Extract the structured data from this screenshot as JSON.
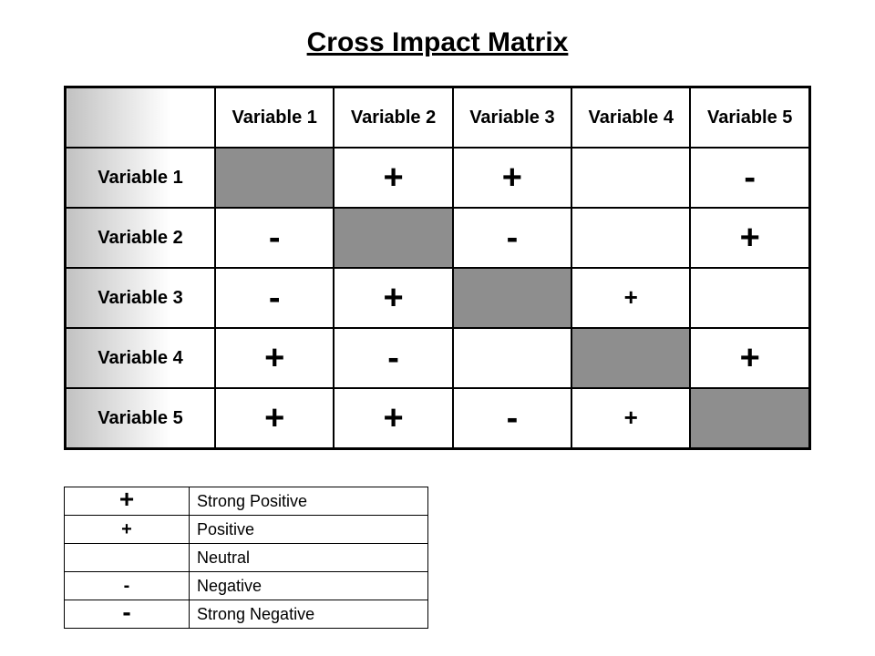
{
  "title": "Cross Impact Matrix",
  "vars": [
    "Variable 1",
    "Variable 2",
    "Variable 3",
    "Variable 4",
    "Variable 5"
  ],
  "matrix": [
    [
      null,
      "+s",
      "+s",
      "",
      "-s"
    ],
    [
      "-s",
      null,
      "-s",
      "",
      "+s"
    ],
    [
      "-s",
      "+s",
      null,
      "+n",
      ""
    ],
    [
      "+s",
      "-s",
      "",
      null,
      "+s"
    ],
    [
      "+s",
      "+s",
      "-s",
      "+n",
      null
    ]
  ],
  "legend": [
    {
      "sym": "+s",
      "label": "Strong Positive"
    },
    {
      "sym": "+n",
      "label": "Positive"
    },
    {
      "sym": "",
      "label": "Neutral"
    },
    {
      "sym": "-n",
      "label": "Negative"
    },
    {
      "sym": "-s",
      "label": "Strong Negative"
    }
  ],
  "chart_data": {
    "type": "table",
    "title": "Cross Impact Matrix",
    "row_labels": [
      "Variable 1",
      "Variable 2",
      "Variable 3",
      "Variable 4",
      "Variable 5"
    ],
    "col_labels": [
      "Variable 1",
      "Variable 2",
      "Variable 3",
      "Variable 4",
      "Variable 5"
    ],
    "cells": [
      [
        null,
        "Strong Positive",
        "Strong Positive",
        "Neutral",
        "Strong Negative"
      ],
      [
        "Strong Negative",
        null,
        "Strong Negative",
        "Neutral",
        "Strong Positive"
      ],
      [
        "Strong Negative",
        "Strong Positive",
        null,
        "Positive",
        "Neutral"
      ],
      [
        "Strong Positive",
        "Strong Negative",
        "Neutral",
        null,
        "Strong Positive"
      ],
      [
        "Strong Positive",
        "Strong Positive",
        "Strong Negative",
        "Positive",
        null
      ]
    ],
    "legend": {
      "Strong Positive": "large +",
      "Positive": "small +",
      "Neutral": "blank",
      "Negative": "small -",
      "Strong Negative": "large -"
    }
  }
}
